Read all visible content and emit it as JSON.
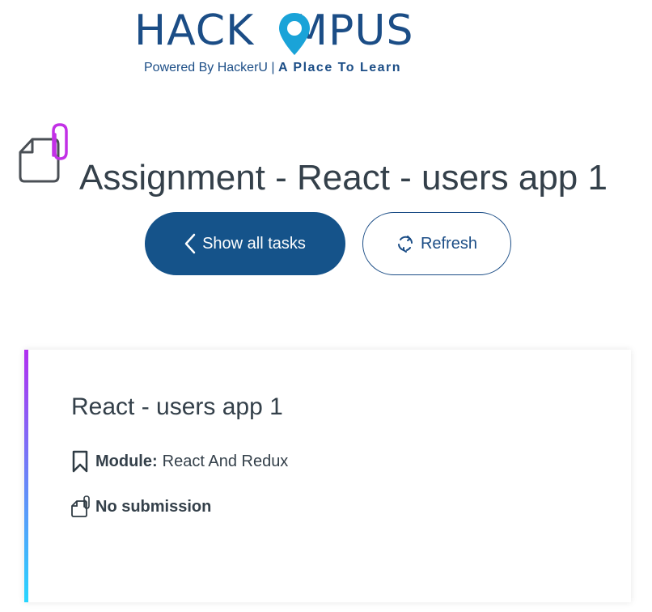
{
  "brand": {
    "name": "HACKOMPUS",
    "name_left": "HACK",
    "name_right": "MPUS",
    "tagline_normal": "Powered By HackerU | ",
    "tagline_bold": "A Place To Learn",
    "color": "#1b4d86"
  },
  "page": {
    "title": "Assignment - React - users app 1",
    "title_icon": "document-paperclip-icon"
  },
  "actions": {
    "show_all_label": "Show all tasks",
    "show_all_icon": "chevron-left-icon",
    "refresh_label": "Refresh",
    "refresh_icon": "refresh-icon",
    "primary_color": "#15538a"
  },
  "task": {
    "title": "React - users app 1",
    "module_label": "Module:",
    "module_value": "React And Redux",
    "module_icon": "bookmark-icon",
    "submission_status": "No submission",
    "submission_icon": "document-paperclip-icon",
    "accent_gradient": [
      "#b12ef0",
      "#27d6ff"
    ]
  }
}
